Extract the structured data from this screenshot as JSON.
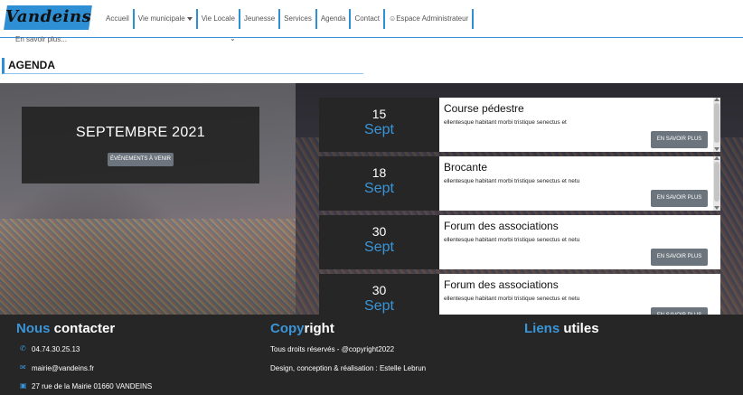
{
  "brand": {
    "logo_text": "Vandeins",
    "accent": "#2f8fd4"
  },
  "nav": {
    "items": [
      {
        "label": "Accueil"
      },
      {
        "label": "Vie municipale",
        "dropdown": true
      },
      {
        "label": "Vie Locale"
      },
      {
        "label": "Jeunesse"
      },
      {
        "label": "Services"
      },
      {
        "label": "Agenda"
      },
      {
        "label": "Contact"
      },
      {
        "label": "Espace Administrateur",
        "icon": "person-icon"
      }
    ]
  },
  "dropdown_preview": {
    "label": "En savoir plus..."
  },
  "agenda": {
    "section_title": "AGENDA",
    "month_title": "SEPTEMBRE 2021",
    "month_badge": "ÉVÉNEMENTS À VENIR",
    "events": [
      {
        "day": "15",
        "month": "Sept",
        "title": "Course pédestre",
        "text": "ellentesque habitant morbi tristique senectus et",
        "button": "EN SAVOIR PLUS"
      },
      {
        "day": "18",
        "month": "Sept",
        "title": "Brocante",
        "text": "ellentesque habitant morbi tristique senectus et netu",
        "button": "EN SAVOIR PLUS"
      },
      {
        "day": "30",
        "month": "Sept",
        "title": "Forum des associations",
        "text": "ellentesque habitant morbi tristique senectus et netu",
        "button": "EN SAVOIR PLUS"
      },
      {
        "day": "30",
        "month": "Sept",
        "title": "Forum des associations",
        "text": "ellentesque habitant morbi tristique senectus et netu",
        "button": "EN SAVOIR PLUS"
      }
    ]
  },
  "footer": {
    "contact": {
      "title_accent": "Nous",
      "title_rest": " contacter",
      "phone": "04.74.30.25.13",
      "email": "mairie@vandeins.fr",
      "address": "27 rue de la Mairie 01660 VANDEINS"
    },
    "copyright": {
      "title_accent": "Copy",
      "title_rest": "right",
      "line1": "Tous droits réservés - @copyright2022",
      "line2": "Design, conception & réalisation : Estelle Lebrun"
    },
    "links": {
      "title_accent": "Liens",
      "title_rest": " utiles"
    }
  },
  "colors": {
    "accent": "#3a95d8",
    "dark": "#262626",
    "button": "#6c757d"
  }
}
